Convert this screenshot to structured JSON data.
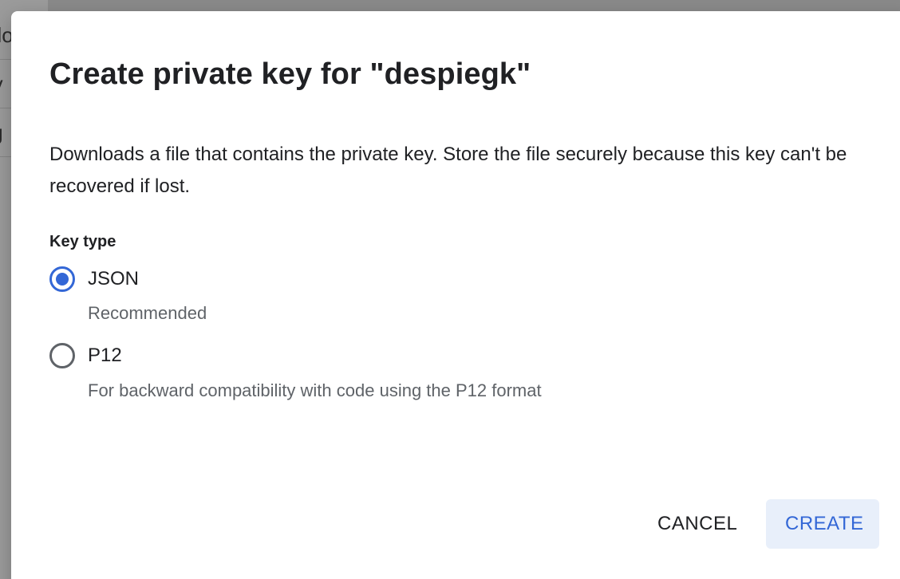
{
  "background": {
    "rows": [
      "elo",
      "rv",
      ".g"
    ]
  },
  "dialog": {
    "title": "Create private key for \"despiegk\"",
    "description": "Downloads a file that contains the private key. Store the file securely because this key can't be recovered if lost.",
    "key_type_label": "Key type",
    "options": [
      {
        "label": "JSON",
        "hint": "Recommended",
        "selected": true
      },
      {
        "label": "P12",
        "hint": "For backward compatibility with code using the P12 format",
        "selected": false
      }
    ],
    "actions": {
      "cancel_label": "CANCEL",
      "create_label": "CREATE"
    }
  },
  "colors": {
    "accent": "#3367d6",
    "create_bg": "#e8effa",
    "text_primary": "#202124",
    "text_secondary": "#5f6368"
  }
}
